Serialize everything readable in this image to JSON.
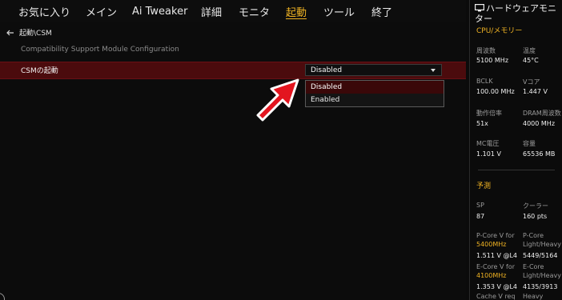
{
  "menubar": {
    "tabs": [
      {
        "label": "お気に入り"
      },
      {
        "label": "メイン"
      },
      {
        "label": "Ai Tweaker"
      },
      {
        "label": "詳細"
      },
      {
        "label": "モニタ"
      },
      {
        "label": "起動",
        "active": true
      },
      {
        "label": "ツール"
      },
      {
        "label": "終了"
      }
    ]
  },
  "main": {
    "breadcrumb": "起動\\CSM",
    "description": "Compatibility Support Module Configuration",
    "setting": {
      "label": "CSMの起動",
      "selected": "Disabled"
    },
    "dropdown": {
      "options": [
        "Disabled",
        "Enabled"
      ]
    }
  },
  "hw_monitor": {
    "title": "ハードウェアモニター",
    "cpu_section": "CPU/メモリー",
    "cpu": {
      "freq_label": "周波数",
      "freq_value": "5100 MHz",
      "temp_label": "温度",
      "temp_value": "45°C",
      "bclk_label": "BCLK",
      "bclk_value": "100.00 MHz",
      "vcore_label": "Vコア",
      "vcore_value": "1.447 V",
      "ratio_label": "動作倍率",
      "ratio_value": "51x",
      "dram_label": "DRAM周波数",
      "dram_value": "4000 MHz",
      "mc_label": "MC電圧",
      "mc_value": "1.101 V",
      "cap_label": "容量",
      "cap_value": "65536 MB"
    },
    "pred_section": "予測",
    "pred": {
      "sp_label": "SP",
      "sp_value": "87",
      "cooler_label": "クーラー",
      "cooler_value": "160 pts",
      "pcore_v_label": "P-Core V for",
      "pcore_v_freq": "5400MHz",
      "pcore_v_value": "1.511 V @L4",
      "pcore_lh_label1": "P-Core",
      "pcore_lh_label2": "Light/Heavy",
      "pcore_lh_value": "5449/5164",
      "ecore_v_label": "E-Core V for",
      "ecore_v_freq": "4100MHz",
      "ecore_v_value": "1.353 V @L4",
      "ecore_lh_label1": "E-Core",
      "ecore_lh_label2": "Light/Heavy",
      "ecore_lh_value": "4135/3913",
      "cache_label": "Cache V req",
      "heavy_label": "Heavy Cache"
    }
  },
  "colors": {
    "accent": "#f0b323",
    "row_highlight": "#4b0b0d",
    "arrow_red": "#e3151f"
  }
}
